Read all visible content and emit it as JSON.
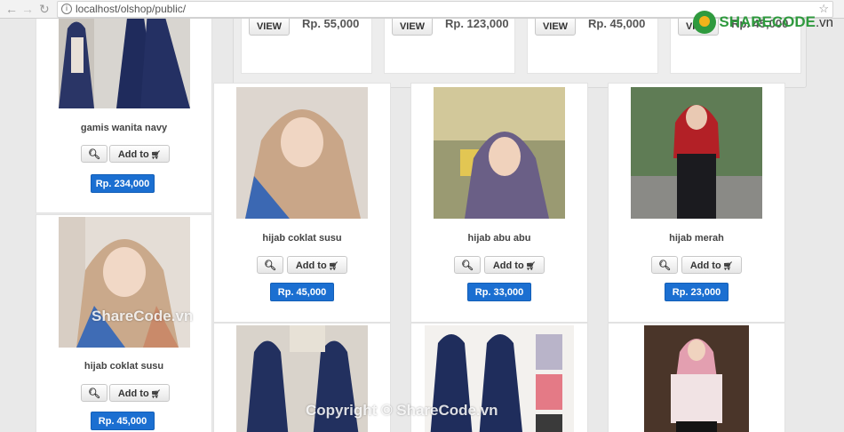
{
  "browser": {
    "url": "localhost/olshop/public/"
  },
  "brand": {
    "logo_main": "SHARECODE",
    "logo_tail": ".vn",
    "watermark_center": "ShareCode.vn",
    "watermark_bottom": "Copyright © ShareCode.vn"
  },
  "top_row": [
    {
      "view_label": "VIEW",
      "price": "Rp. 55,000"
    },
    {
      "view_label": "VIEW",
      "price": "Rp. 123,000"
    },
    {
      "view_label": "VIEW",
      "price": "Rp. 45,000"
    },
    {
      "view_label": "VIEW",
      "price": "Rp. 45,000"
    }
  ],
  "sidebar": [
    {
      "name": "gamis wanita navy",
      "add_label": "Add to",
      "price": "Rp. 234,000"
    },
    {
      "name": "hijab coklat susu",
      "add_label": "Add to",
      "price": "Rp. 45,000"
    }
  ],
  "products": [
    {
      "name": "hijab coklat susu",
      "add_label": "Add to",
      "price": "Rp. 45,000"
    },
    {
      "name": "hijab abu abu",
      "add_label": "Add to",
      "price": "Rp. 33,000"
    },
    {
      "name": "hijab merah",
      "add_label": "Add to",
      "price": "Rp. 23,000"
    }
  ],
  "colors": {
    "price_bg": "#1b6fd1",
    "logo_green": "#2f9a3e",
    "logo_yellow": "#f2b31b"
  }
}
